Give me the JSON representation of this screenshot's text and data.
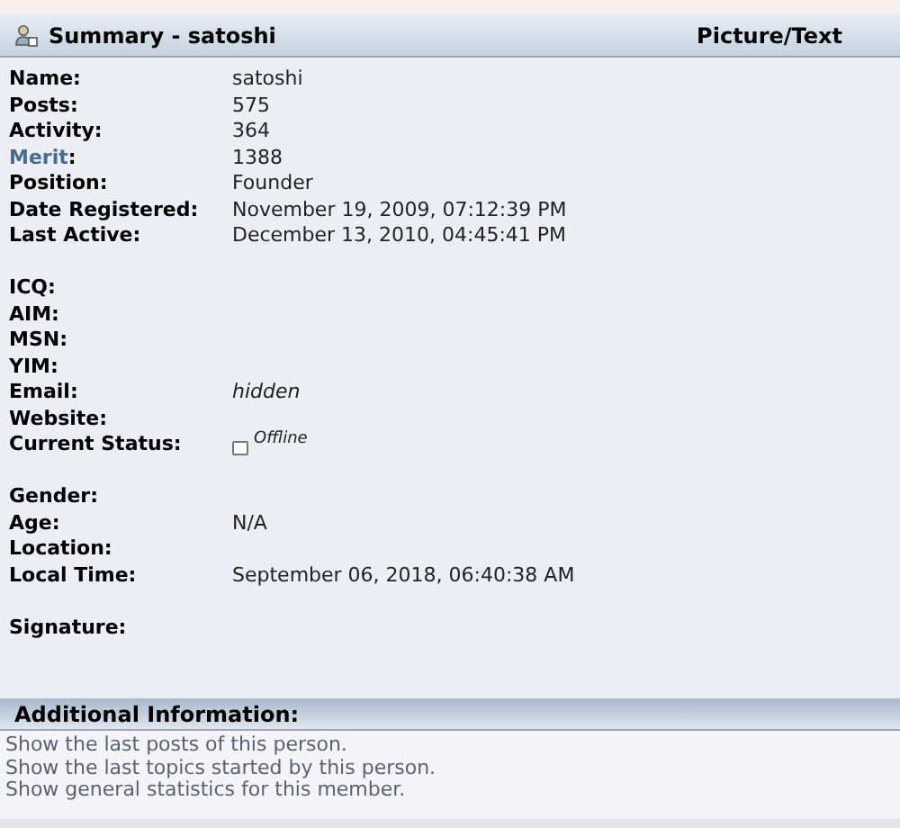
{
  "summary": {
    "title": "Summary - satoshi",
    "link": "Picture/Text",
    "groups": [
      [
        {
          "label": "Name:",
          "value": "satoshi",
          "kind": "plain",
          "label_link": false
        },
        {
          "label": "Posts:",
          "value": "575",
          "kind": "plain",
          "label_link": false
        },
        {
          "label": "Activity:",
          "value": "364",
          "kind": "plain",
          "label_link": false
        },
        {
          "label": "Merit",
          "colon": ":",
          "value": "1388",
          "kind": "plain",
          "label_link": true
        },
        {
          "label": "Position:",
          "value": "Founder",
          "kind": "plain",
          "label_link": false
        },
        {
          "label": "Date Registered:",
          "value": "November 19, 2009, 07:12:39 PM",
          "kind": "plain",
          "label_link": false
        },
        {
          "label": "Last Active:",
          "value": "December 13, 2010, 04:45:41 PM",
          "kind": "plain",
          "label_link": false
        }
      ],
      [
        {
          "label": "ICQ:",
          "label_link": false
        },
        {
          "label": "AIM:",
          "label_link": false
        },
        {
          "label": "MSN:",
          "label_link": false
        },
        {
          "label": "YIM:",
          "label_link": false
        },
        {
          "label": "Email:",
          "value": "hidden",
          "kind": "italic",
          "label_link": false
        },
        {
          "label": "Website:",
          "label_link": false
        },
        {
          "label": "Current Status:",
          "value": "Offline",
          "kind": "status",
          "label_link": false
        }
      ],
      [
        {
          "label": "Gender:",
          "label_link": false
        },
        {
          "label": "Age:",
          "value": "N/A",
          "kind": "plain",
          "label_link": false
        },
        {
          "label": "Location:",
          "label_link": false
        },
        {
          "label": "Local Time:",
          "value": "September 06, 2018, 06:40:38 AM",
          "kind": "plain",
          "label_link": false
        }
      ],
      [
        {
          "label": "Signature:",
          "label_link": false
        }
      ]
    ]
  },
  "additional": {
    "title": "Additional Information:",
    "links": [
      "Show the last posts of this person.",
      "Show the last topics started by this person.",
      "Show general statistics for this member."
    ]
  }
}
